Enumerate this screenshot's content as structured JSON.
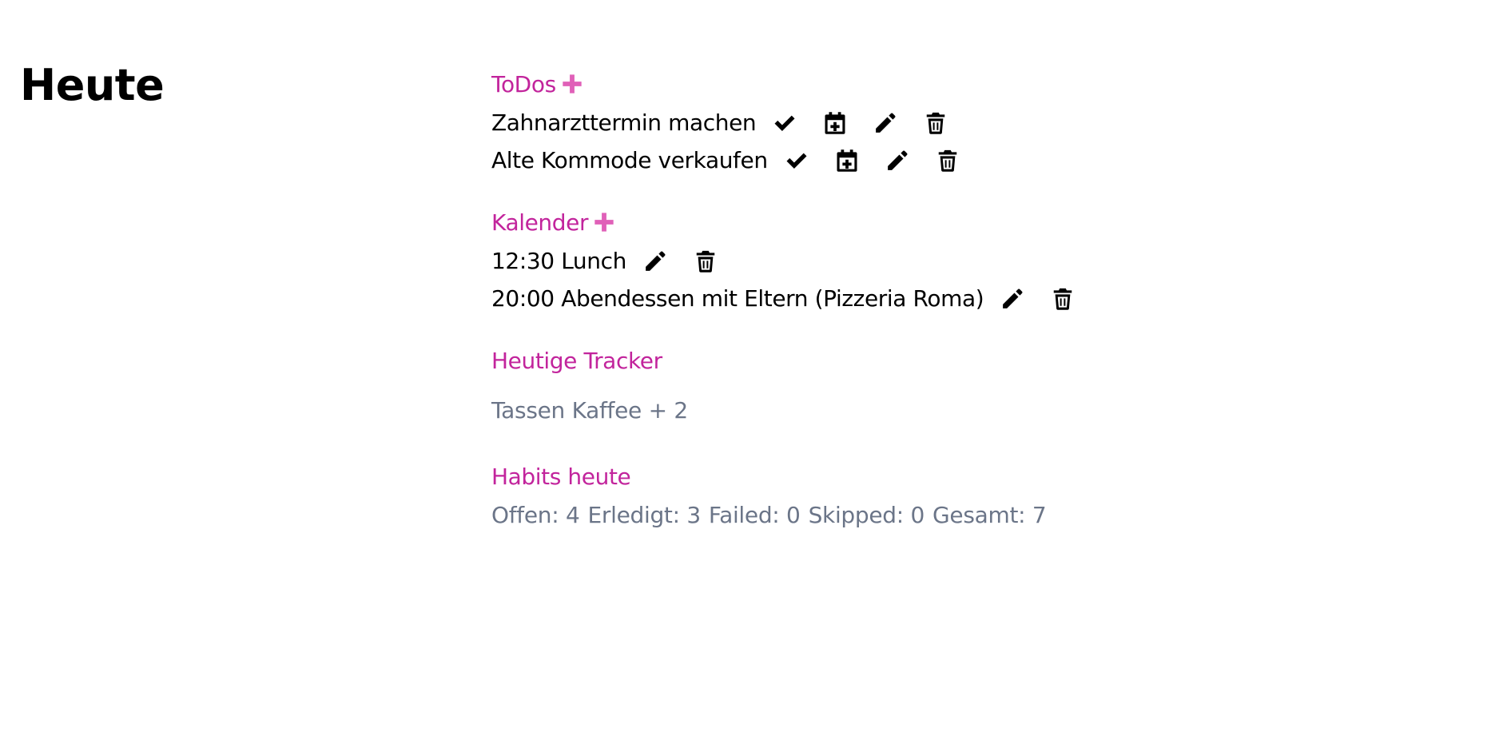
{
  "page": {
    "title": "Heute"
  },
  "todos": {
    "heading": "ToDos",
    "items": [
      {
        "label": "Zahnarzttermin machen"
      },
      {
        "label": "Alte Kommode verkaufen"
      }
    ]
  },
  "calendar": {
    "heading": "Kalender",
    "events": [
      {
        "label": "12:30 Lunch"
      },
      {
        "label": "20:00 Abendessen mit Eltern (Pizzeria Roma)"
      }
    ]
  },
  "trackers": {
    "heading": "Heutige Tracker",
    "items": [
      {
        "label": "Tassen Kaffee + 2"
      }
    ]
  },
  "habits": {
    "heading": "Habits heute",
    "stats": [
      {
        "text": "Offen: 4"
      },
      {
        "text": "Erledigt: 3"
      },
      {
        "text": "Failed: 0"
      },
      {
        "text": "Skipped: 0"
      },
      {
        "text": "Gesamt: 7"
      }
    ]
  },
  "icons": {
    "add": "plus-icon",
    "done": "checkmark-icon",
    "schedule": "calendar-plus-icon",
    "edit": "pencil-icon",
    "delete": "trash-icon"
  },
  "colors": {
    "heading": "#c2249c",
    "add_icon": "#e060b8",
    "muted_text": "#6b7588",
    "text": "#000000",
    "background": "#ffffff"
  }
}
